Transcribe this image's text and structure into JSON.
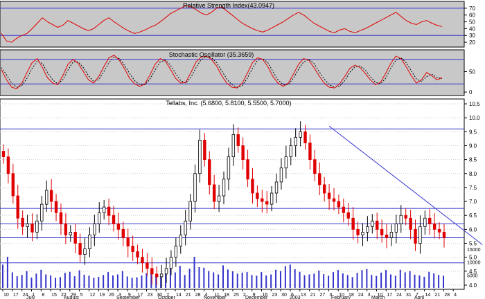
{
  "colors": {
    "panel_bg": "#c8c8c8",
    "main_bg": "#ffffff",
    "grid": "#d0d0d0",
    "band_line": "#3333cc",
    "rsi_line": "#e00000",
    "stoch_k": "#e00000",
    "stoch_d": "#000000",
    "up_candle": "#000000",
    "down_candle": "#e00000",
    "trendline": "#3333cc",
    "volume": "#3333cc"
  },
  "chart_data": [
    {
      "type": "line",
      "name": "rsi",
      "title": "Relative Strength Index(43.0947)",
      "yticks": [
        20,
        30,
        40,
        50,
        60,
        70
      ],
      "ylim": [
        15,
        78
      ],
      "bands": [
        30,
        70
      ],
      "series": [
        {
          "name": "RSI",
          "values": [
            33,
            22,
            20,
            26,
            30,
            33,
            40,
            48,
            56,
            50,
            46,
            42,
            45,
            52,
            48,
            44,
            40,
            37,
            40,
            46,
            52,
            56,
            50,
            45,
            40,
            36,
            33,
            35,
            38,
            42,
            45,
            50,
            56,
            62,
            66,
            70,
            74,
            72,
            68,
            63,
            60,
            64,
            70,
            72,
            66,
            60,
            54,
            48,
            44,
            40,
            37,
            35,
            38,
            42,
            46,
            50,
            55,
            60,
            64,
            60,
            54,
            48,
            44,
            40,
            36,
            34,
            38,
            40,
            36,
            34,
            37,
            40,
            44,
            48,
            52,
            56,
            60,
            64,
            58,
            52,
            48,
            46,
            50,
            52,
            48,
            45,
            43
          ]
        }
      ]
    },
    {
      "type": "line",
      "name": "stochastic",
      "title": "Stochastic Oscillator (35.3659)",
      "yticks": [
        0,
        50
      ],
      "ylim": [
        -5,
        100
      ],
      "bands": [
        20,
        80
      ],
      "series": [
        {
          "name": "%K",
          "values": [
            55,
            30,
            12,
            8,
            22,
            48,
            72,
            82,
            60,
            35,
            22,
            18,
            40,
            68,
            80,
            70,
            50,
            30,
            22,
            38,
            62,
            84,
            90,
            78,
            58,
            34,
            20,
            14,
            20,
            42,
            68,
            82,
            76,
            56,
            34,
            22,
            24,
            48,
            74,
            86,
            88,
            80,
            64,
            40,
            22,
            12,
            10,
            22,
            46,
            72,
            84,
            80,
            62,
            38,
            22,
            14,
            22,
            44,
            68,
            82,
            78,
            60,
            40,
            22,
            12,
            10,
            20,
            38,
            58,
            66,
            60,
            46,
            30,
            18,
            24,
            46,
            70,
            88,
            82,
            62,
            40,
            22,
            30,
            48,
            40,
            30,
            35
          ]
        },
        {
          "name": "%D",
          "values": [
            60,
            42,
            22,
            12,
            16,
            34,
            58,
            76,
            70,
            48,
            30,
            20,
            30,
            54,
            74,
            74,
            60,
            40,
            26,
            30,
            50,
            72,
            86,
            82,
            66,
            46,
            28,
            18,
            18,
            32,
            54,
            74,
            78,
            66,
            46,
            28,
            22,
            36,
            60,
            80,
            86,
            84,
            72,
            52,
            32,
            18,
            12,
            16,
            34,
            58,
            78,
            82,
            72,
            50,
            30,
            18,
            18,
            34,
            56,
            74,
            80,
            70,
            50,
            32,
            18,
            12,
            14,
            28,
            48,
            62,
            64,
            54,
            38,
            24,
            20,
            34,
            58,
            78,
            84,
            72,
            52,
            32,
            26,
            38,
            44,
            36,
            33
          ]
        }
      ]
    },
    {
      "type": "candlestick",
      "name": "price",
      "title": "Tellabs, Inc. (5.6800, 5.8100, 5.5500, 5.7000)",
      "yticks": [
        4.0,
        4.5,
        5.0,
        5.5,
        6.0,
        6.5,
        7.0,
        7.5,
        8.0,
        8.5,
        9.0,
        9.5,
        10.0,
        10.5
      ],
      "ylim": [
        3.9,
        10.6
      ],
      "hlines": [
        9.6,
        6.75,
        6.2,
        5.7,
        4.8
      ],
      "trendline": {
        "from": {
          "index": 68,
          "value": 9.7
        },
        "to": {
          "index": 100,
          "value": 5.45
        }
      },
      "closes": [
        8.6,
        8.0,
        7.2,
        6.4,
        6.1,
        6.2,
        5.9,
        6.3,
        6.9,
        7.4,
        7.0,
        6.6,
        6.2,
        5.8,
        5.9,
        5.5,
        5.1,
        5.3,
        5.8,
        6.2,
        6.6,
        6.8,
        6.5,
        6.2,
        6.0,
        5.7,
        5.4,
        5.2,
        5.0,
        4.8,
        4.6,
        4.4,
        4.3,
        4.4,
        4.6,
        5.0,
        5.4,
        5.8,
        6.3,
        7.0,
        8.0,
        9.2,
        8.5,
        7.6,
        7.0,
        7.2,
        7.8,
        8.6,
        9.4,
        9.0,
        8.5,
        7.8,
        7.3,
        7.1,
        7.0,
        6.9,
        7.3,
        7.7,
        8.2,
        8.6,
        9.0,
        9.3,
        9.5,
        9.1,
        8.5,
        8.0,
        7.6,
        7.3,
        7.1,
        7.0,
        6.8,
        6.6,
        6.4,
        6.0,
        5.8,
        5.9,
        6.1,
        6.3,
        6.0,
        5.8,
        5.7,
        5.9,
        6.2,
        6.5,
        6.4,
        6.0,
        5.5,
        6.1,
        6.4,
        6.2,
        6.0,
        5.9,
        5.7
      ],
      "y_axis_label_note": ""
    },
    {
      "type": "bar",
      "name": "volume",
      "yticks": [
        5000,
        10000,
        15000
      ],
      "ylim": [
        0,
        16000
      ],
      "values": [
        9000,
        12000,
        6000,
        4500,
        5000,
        6500,
        4000,
        5500,
        7000,
        5200,
        4800,
        3900,
        4200,
        5800,
        6200,
        4500,
        6800,
        5100,
        4700,
        3900,
        4300,
        5000,
        6100,
        4800,
        5200,
        6500,
        4400,
        3900,
        4100,
        4800,
        5700,
        6900,
        5200,
        4600,
        7000,
        9500,
        6000,
        8500,
        5000,
        7400,
        12000,
        8000,
        7800,
        6500,
        6000,
        5200,
        8700,
        7100,
        6400,
        5500,
        5900,
        6100,
        5000,
        4700,
        6100,
        4800,
        5200,
        7000,
        6500,
        8400,
        9000,
        7200,
        6200,
        4900,
        5200,
        5500,
        6700,
        5300,
        4700,
        6100,
        6900,
        5600,
        5000,
        4200,
        5800,
        6900,
        7300,
        5000,
        4600,
        5900,
        6900,
        5200,
        4700,
        7000,
        6000,
        6500,
        5100,
        4800,
        4300,
        6200,
        5600,
        5000,
        4700
      ]
    }
  ],
  "axis": {
    "day_labels": [
      "10",
      "17",
      "24",
      "1",
      "8",
      "15",
      "22",
      "29",
      "5",
      "12",
      "19",
      "26",
      "3",
      "9",
      "17",
      "23",
      "30",
      "7",
      "14",
      "21",
      "28",
      "4",
      "11",
      "18",
      "25",
      "2",
      "9",
      "16",
      "23",
      "30",
      "6",
      "13",
      "21",
      "27",
      "3",
      "10",
      "18",
      "24",
      "3",
      "10",
      "17",
      "24",
      "31",
      "7",
      "14",
      "21",
      "28",
      "4"
    ],
    "month_labels": [
      "July",
      "August",
      "September",
      "October",
      "November",
      "December",
      "2003",
      "February",
      "March",
      "April"
    ]
  }
}
